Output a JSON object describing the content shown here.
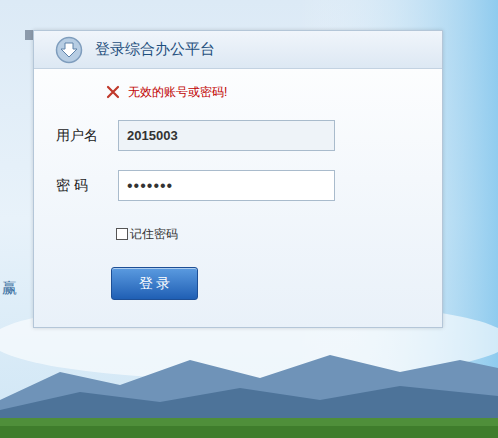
{
  "panel": {
    "title": "登录综合办公平台"
  },
  "error": {
    "text": "无效的账号或密码!"
  },
  "fields": [
    {
      "label": "用户名",
      "value": "2015003",
      "kind": "text",
      "filled": true
    },
    {
      "label": "密 码",
      "value": "•••••••",
      "kind": "password",
      "filled": false
    }
  ],
  "remember": {
    "label": "记住密码",
    "checked": false
  },
  "buttons": [
    "登 录"
  ],
  "background_text": "赢"
}
